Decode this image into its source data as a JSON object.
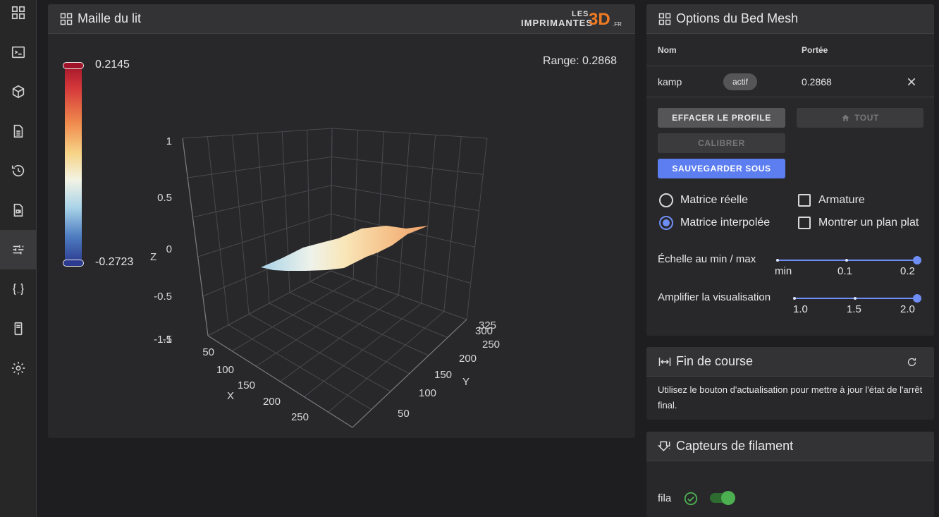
{
  "sidebar": {
    "items": [
      {
        "icon": "dashboard-icon"
      },
      {
        "icon": "console-icon"
      },
      {
        "icon": "cube-icon"
      },
      {
        "icon": "file-icon"
      },
      {
        "icon": "history-icon"
      },
      {
        "icon": "video-file-icon"
      },
      {
        "icon": "tune-icon",
        "active": true
      },
      {
        "icon": "code-braces-icon"
      },
      {
        "icon": "printer-icon"
      },
      {
        "icon": "gear-icon"
      }
    ]
  },
  "mesh_panel": {
    "title": "Maille du lit",
    "logo_les": "LES",
    "logo_imprimantes": "IMPRIMANTES",
    "logo_3d": "3D",
    "logo_fr": ".FR",
    "range_text": "Range: 0.2868",
    "colorbar_max": "0.2145",
    "colorbar_min": "-0.2723"
  },
  "chart_data": {
    "type": "surface3d",
    "z_axis": {
      "label": "Z",
      "ticks": [
        "1",
        "0.5",
        "0",
        "-0.5",
        "-1",
        "-1.5"
      ],
      "range": [
        -1.5,
        1
      ]
    },
    "x_axis": {
      "label": "X",
      "ticks": [
        "50",
        "100",
        "150",
        "200",
        "250"
      ]
    },
    "y_axis": {
      "label": "Y",
      "ticks": [
        "50",
        "100",
        "150",
        "200",
        "250",
        "300",
        "325"
      ]
    },
    "z_min": -0.2723,
    "z_max": 0.2145,
    "range": 0.2868,
    "colorscale": [
      "#2c3a8f",
      "#4f7fc2",
      "#a9d3e8",
      "#f3f3e4",
      "#f6d488",
      "#f08c4e",
      "#d4373a",
      "#a0142a"
    ]
  },
  "options_panel": {
    "title": "Options du Bed Mesh",
    "col_name": "Nom",
    "col_range": "Portée",
    "profile": {
      "name": "kamp",
      "badge": "actif",
      "range": "0.2868"
    },
    "btn_clear": "EFFACER LE PROFILE",
    "btn_home": "TOUT",
    "btn_calibrate": "CALIBRER",
    "btn_save": "SAUVEGARDER SOUS",
    "radio_real": "Matrice réelle",
    "radio_interpolated": "Matrice interpolée",
    "check_wireframe": "Armature",
    "check_flat": "Montrer un plan plat",
    "scale_label": "Échelle au min / max",
    "scale_ticks": [
      "min",
      "0.1",
      "0.2"
    ],
    "scale_value": "0.2",
    "amplify_label": "Amplifier la visualisation",
    "amplify_ticks": [
      "1.0",
      "1.5",
      "2.0"
    ],
    "amplify_value": "2.0"
  },
  "endstop_panel": {
    "title": "Fin de course",
    "text": "Utilisez le bouton d'actualisation pour mettre à jour l'état de l'arrêt final."
  },
  "filament_panel": {
    "title": "Capteurs de filament",
    "sensor_name": "fila",
    "enabled": true
  }
}
